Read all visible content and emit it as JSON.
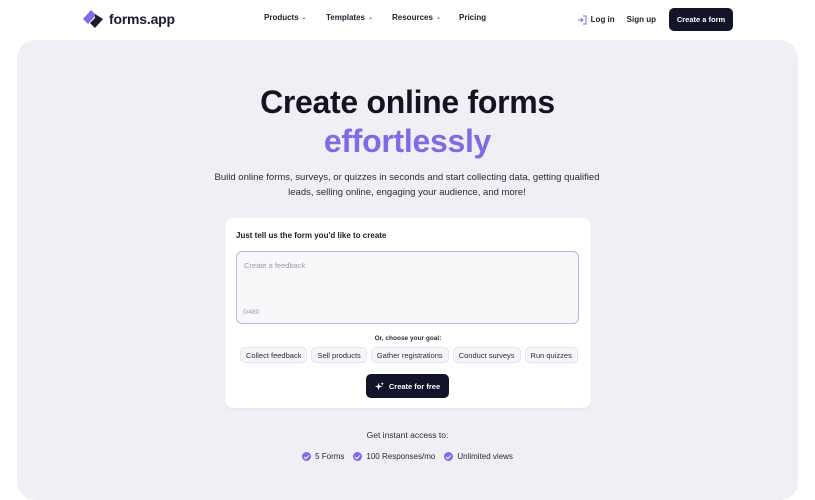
{
  "brand": {
    "name": "forms.app",
    "accent": "#7d6ce6",
    "dark": "#131329"
  },
  "nav": {
    "items": [
      {
        "label": "Products",
        "has_dropdown": true
      },
      {
        "label": "Templates",
        "has_dropdown": true
      },
      {
        "label": "Resources",
        "has_dropdown": true
      },
      {
        "label": "Pricing",
        "has_dropdown": false
      }
    ],
    "login": "Log in",
    "signup": "Sign up",
    "cta": "Create a form"
  },
  "hero": {
    "title": "Create online forms",
    "title_accent": "effortlessly",
    "subtitle": "Build online forms, surveys, or quizzes in seconds and start collecting data, getting qualified leads, selling online, engaging your audience, and more!"
  },
  "card": {
    "title": "Just tell us the form you'd like to create",
    "placeholder": "Create a feedback",
    "counter": "0/480",
    "goal_label": "Or, choose your goal:",
    "goals": [
      "Collect feedback",
      "Sell products",
      "Gather registrations",
      "Conduct surveys",
      "Run quizzes"
    ],
    "button": "Create for free"
  },
  "access": {
    "label": "Get instant access to:",
    "perks": [
      "5 Forms",
      "100 Responses/mo",
      "Unlimited views"
    ]
  }
}
